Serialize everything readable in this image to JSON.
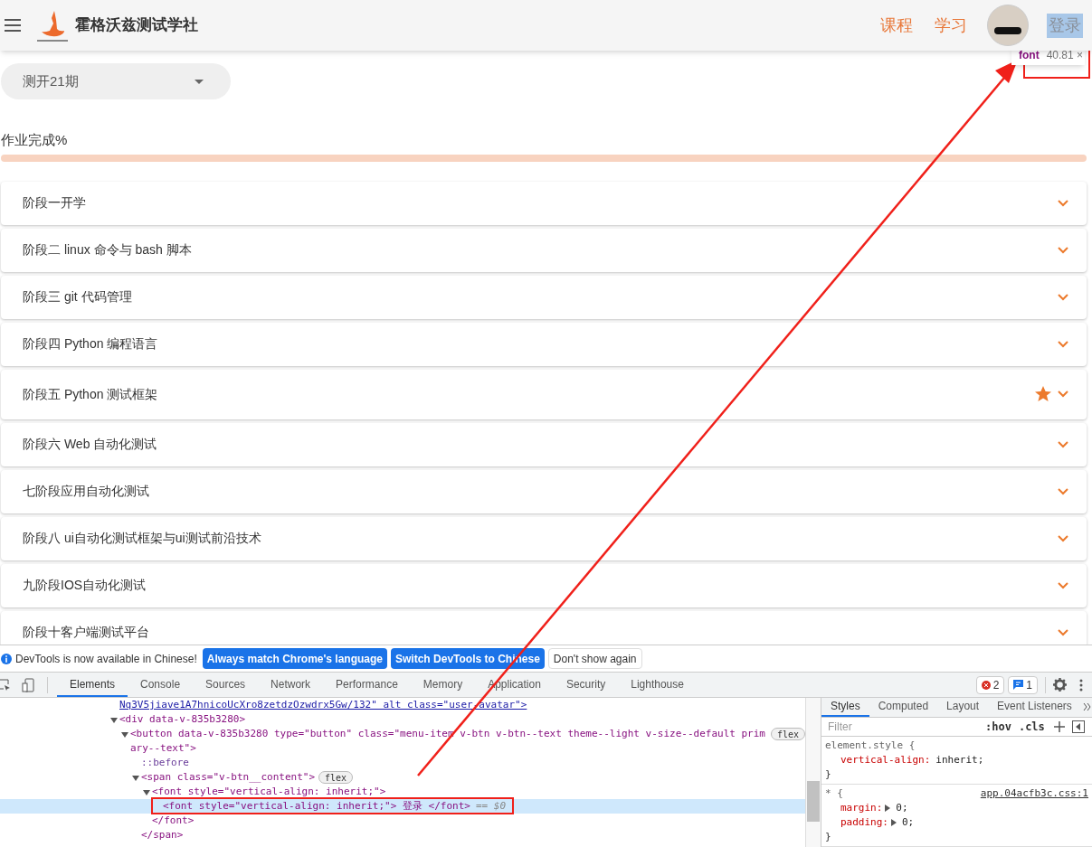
{
  "header": {
    "title": "霍格沃兹测试学社",
    "nav": [
      {
        "label": "课程",
        "highlighted": false
      },
      {
        "label": "学习",
        "highlighted": false
      },
      {
        "label": "登录",
        "highlighted": true
      }
    ],
    "inspect_tooltip": {
      "tag": "font",
      "size": "40.81 ×"
    }
  },
  "class_select": {
    "value": "测开21期"
  },
  "progress": {
    "label": "作业完成%",
    "level": 0
  },
  "stages": [
    {
      "title": "阶段一开学",
      "starred": false
    },
    {
      "title": "阶段二 linux 命令与 bash 脚本",
      "starred": false
    },
    {
      "title": "阶段三 git 代码管理",
      "starred": false
    },
    {
      "title": "阶段四 Python 编程语言",
      "starred": false
    },
    {
      "title": "阶段五 Python 测试框架",
      "starred": true
    },
    {
      "title": "阶段六 Web 自动化测试",
      "starred": false
    },
    {
      "title": "七阶段应用自动化测试",
      "starred": false
    },
    {
      "title": "阶段八 ui自动化测试框架与ui测试前沿技术",
      "starred": false
    },
    {
      "title": "九阶段IOS自动化测试",
      "starred": false
    },
    {
      "title": "阶段十客户端测试平台",
      "starred": false
    }
  ],
  "devtools": {
    "banner": {
      "message": "DevTools is now available in Chinese!",
      "buttons": [
        {
          "label": "Always match Chrome's language",
          "kind": "primary"
        },
        {
          "label": "Switch DevTools to Chinese",
          "kind": "primary"
        },
        {
          "label": "Don't show again",
          "kind": "secondary"
        }
      ]
    },
    "tabs": [
      {
        "label": "Elements",
        "selected": true
      },
      {
        "label": "Console",
        "selected": false
      },
      {
        "label": "Sources",
        "selected": false
      },
      {
        "label": "Network",
        "selected": false
      },
      {
        "label": "Performance",
        "selected": false
      },
      {
        "label": "Memory",
        "selected": false
      },
      {
        "label": "Application",
        "selected": false
      },
      {
        "label": "Security",
        "selected": false
      },
      {
        "label": "Lighthouse",
        "selected": false
      }
    ],
    "errors": "2",
    "messages": "1",
    "dom": [
      {
        "text": "Nq3V5jiave1A7hnicoUcXro8zetdzOzwdrx5Gw/132\" alt class=\"user-avatar\">",
        "kind": "tail",
        "selected": false
      },
      {
        "text": "<div data-v-835b3280>",
        "kind": "tag",
        "expanded": true,
        "selected": false,
        "children": [
          {
            "text": "<button data-v-835b3280 type=\"button\" class=\"menu-item v-btn v-btn--text theme--light v-size--default primary--text\">",
            "kind": "tag",
            "expanded": true,
            "badge": "flex",
            "selected": false,
            "children": [
              {
                "text": "::before",
                "kind": "pseudo",
                "selected": false
              },
              {
                "text": "<span class=\"v-btn__content\">",
                "kind": "tag",
                "expanded": true,
                "badge": "flex",
                "selected": false,
                "children": [
                  {
                    "text": "<font style=\"vertical-align: inherit;\">",
                    "kind": "tag",
                    "expanded": true,
                    "selected": false,
                    "children": [
                      {
                        "text": "<font style=\"vertical-align: inherit;\"> 登录 </font>",
                        "kind": "tag",
                        "selected": true,
                        "suffix": "== $0"
                      }
                    ]
                  },
                  {
                    "text": "</font>",
                    "kind": "tag",
                    "selected": false
                  }
                ]
              },
              {
                "text": "</span>",
                "kind": "tag",
                "selected": false
              }
            ]
          }
        ]
      }
    ],
    "style_tabs": [
      {
        "label": "Styles",
        "selected": true
      },
      {
        "label": "Computed",
        "selected": false
      },
      {
        "label": "Layout",
        "selected": false
      },
      {
        "label": "Event Listeners",
        "selected": false
      }
    ],
    "filter_placeholder": "Filter",
    "filter_tools": [
      ":hov",
      ".cls"
    ],
    "rules": [
      {
        "selector": "element.style {",
        "decls": [
          {
            "prop": "vertical-align:",
            "value": "inherit;",
            "expandable": false
          }
        ],
        "close": "}"
      },
      {
        "selector": "* {",
        "source": "app.04acfb3c.css:1",
        "decls": [
          {
            "prop": "margin:",
            "value": "0;",
            "expandable": true
          },
          {
            "prop": "padding:",
            "value": "0;",
            "expandable": true
          }
        ],
        "close": "}"
      }
    ]
  }
}
